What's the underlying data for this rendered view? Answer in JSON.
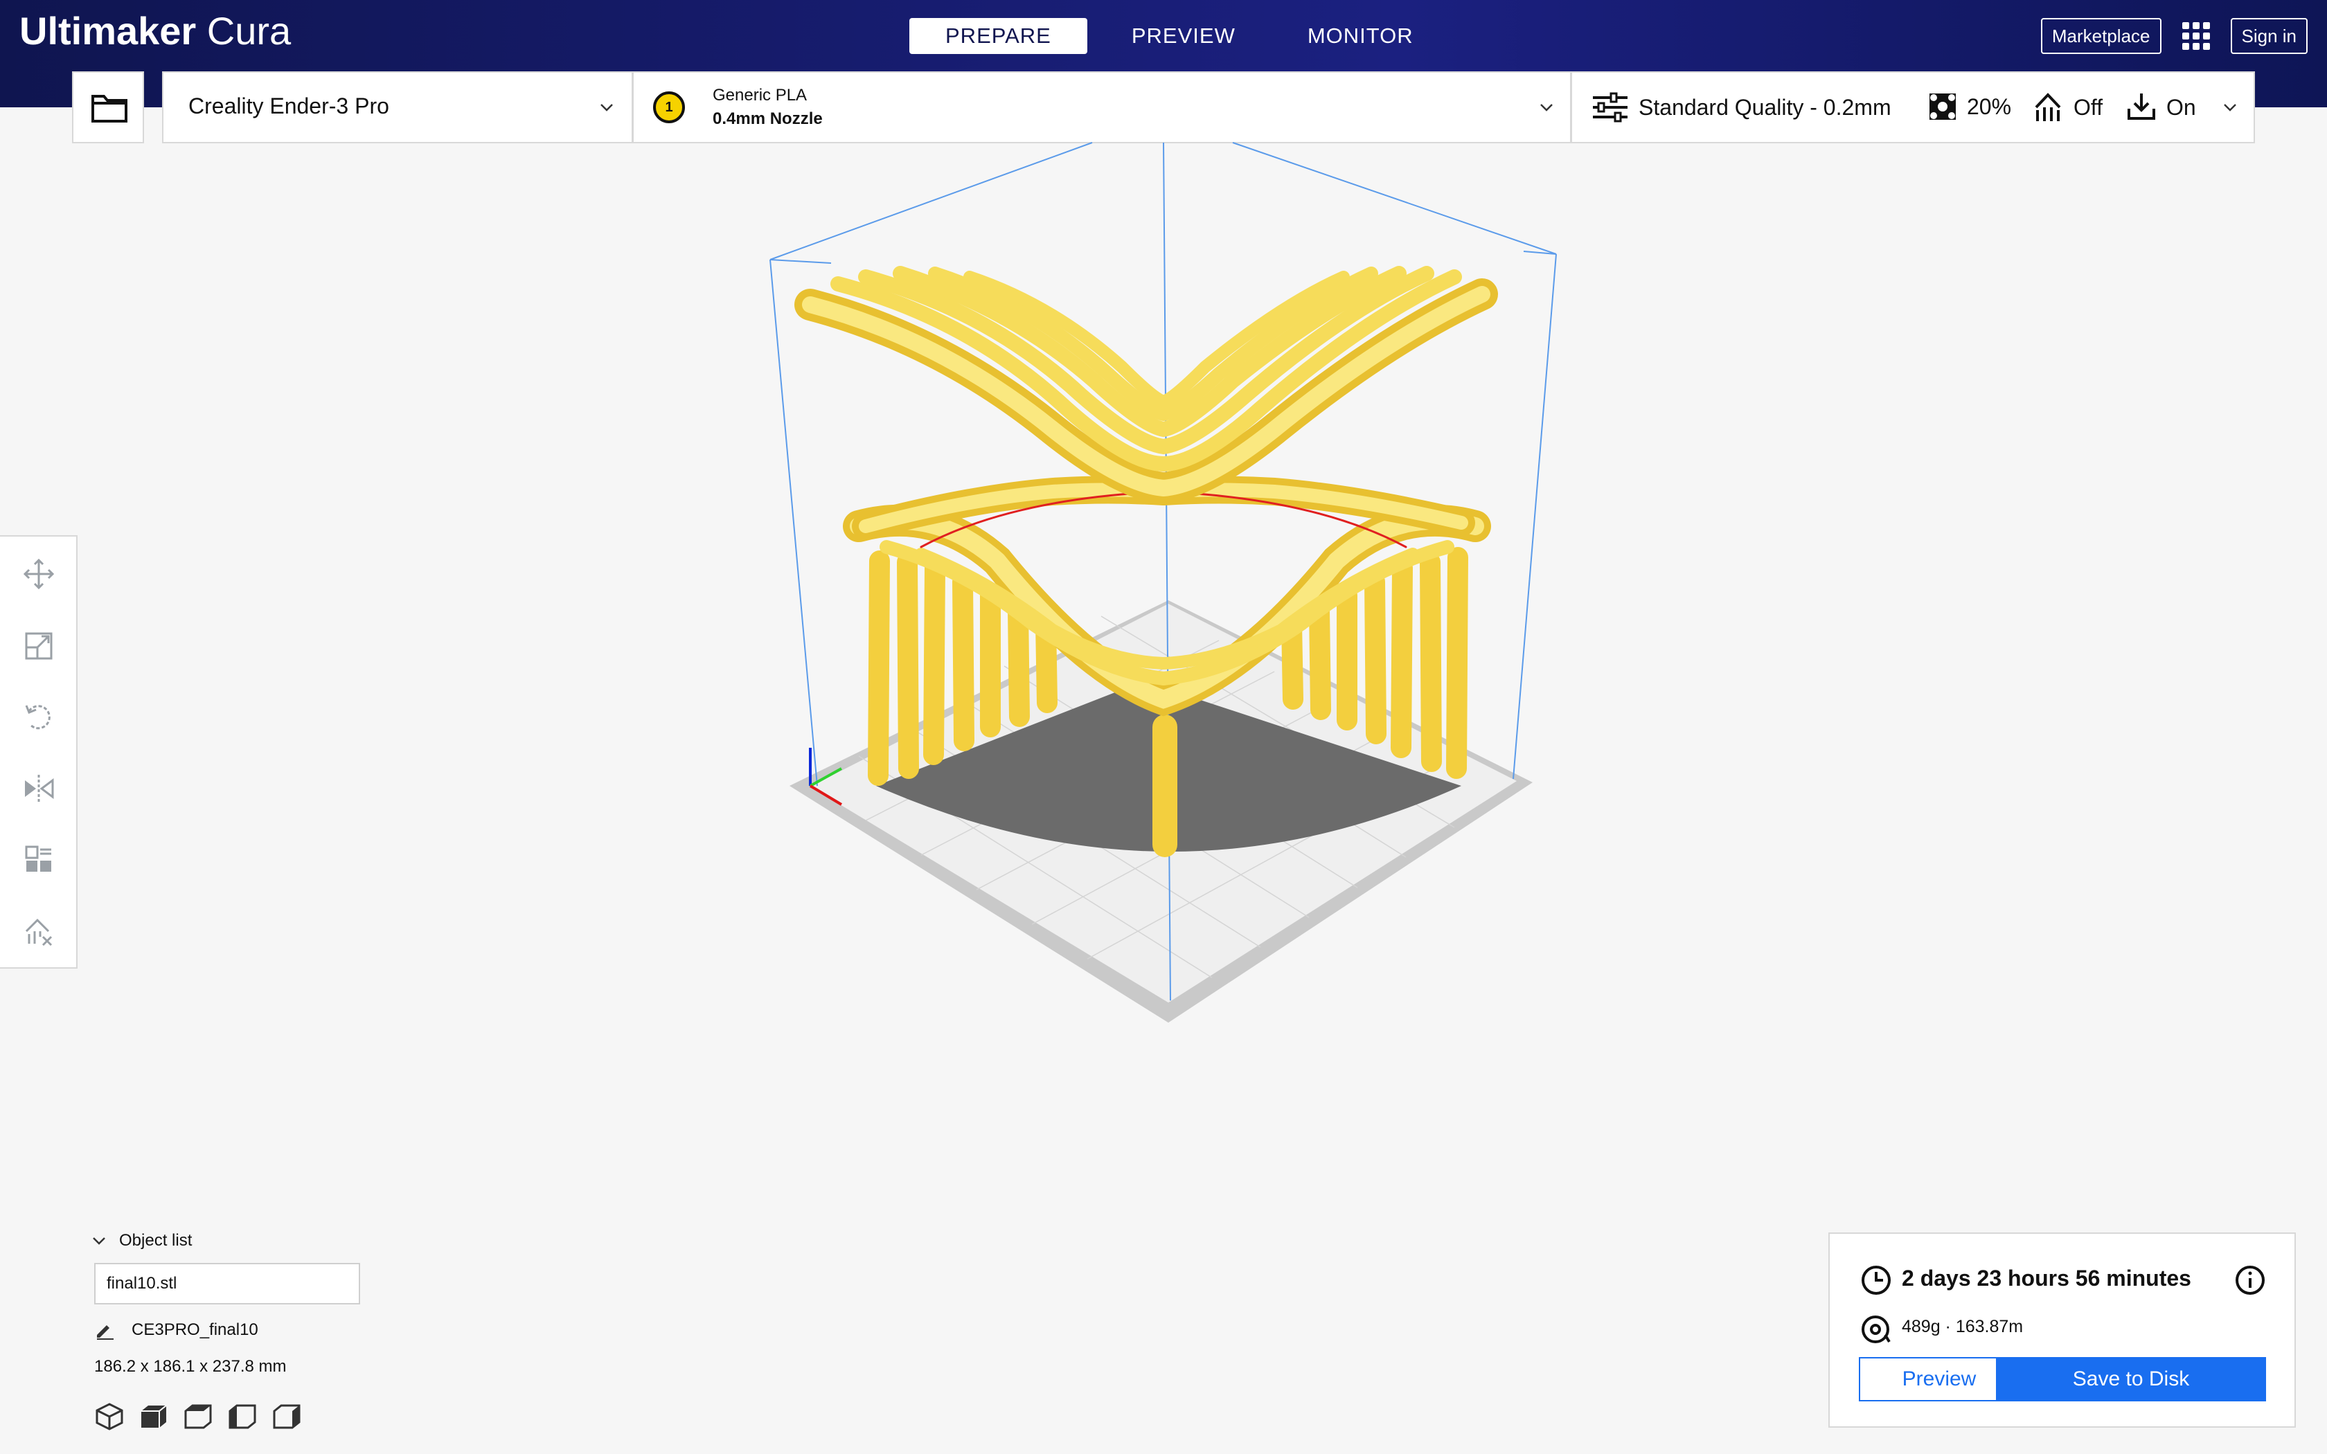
{
  "header": {
    "brand_bold": "Ultimaker",
    "brand_light": " Cura",
    "stages": [
      "PREPARE",
      "PREVIEW",
      "MONITOR"
    ],
    "active_stage": "PREPARE",
    "marketplace_label": "Marketplace",
    "signin_label": "Sign in"
  },
  "toolbar": {
    "printer_name": "Creality Ender-3 Pro",
    "material_extruder": "1",
    "material_name": "Generic PLA",
    "nozzle": "0.4mm Nozzle",
    "quality": "Standard Quality - 0.2mm",
    "infill": "20%",
    "support": "Off",
    "adhesion": "On"
  },
  "object_list": {
    "title": "Object list",
    "file": "final10.stl",
    "job_name": "CE3PRO_final10",
    "dimensions": "186.2 x 186.1 x 237.8 mm"
  },
  "print_info": {
    "time": "2 days 23 hours 56 minutes",
    "material": "489g · 163.87m",
    "preview_label": "Preview",
    "save_label": "Save to Disk"
  },
  "colors": {
    "header_bg": "#10154f",
    "accent": "#196ef0",
    "model": "#f8e06a",
    "bed_gray": "#6b6b6b"
  }
}
